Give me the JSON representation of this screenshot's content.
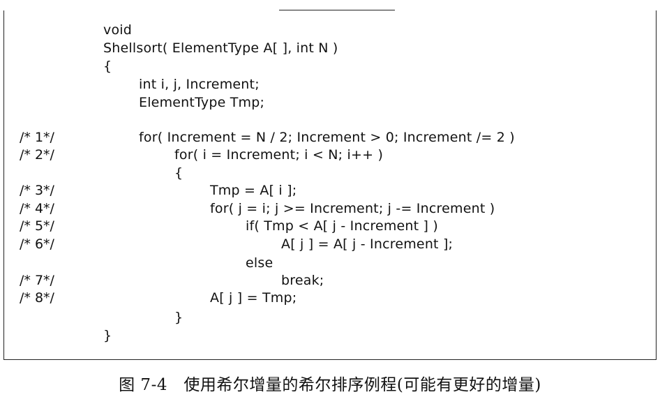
{
  "code": {
    "lines": [
      {
        "number": "",
        "text": "void",
        "indent": 0
      },
      {
        "number": "",
        "text": "Shellsort( ElementType A[ ], int N )",
        "indent": 0
      },
      {
        "number": "",
        "text": "{",
        "indent": 0
      },
      {
        "number": "",
        "text": "int i, j, Increment;",
        "indent": 1
      },
      {
        "number": "",
        "text": "ElementType Tmp;",
        "indent": 1
      },
      {
        "number": "",
        "text": "",
        "indent": 0
      },
      {
        "number": "/* 1*/",
        "text": "for( Increment = N / 2; Increment > 0; Increment /= 2 )",
        "indent": 1
      },
      {
        "number": "/* 2*/",
        "text": "for( i = Increment; i < N; i++ )",
        "indent": 2
      },
      {
        "number": "",
        "text": "{",
        "indent": 2
      },
      {
        "number": "/* 3*/",
        "text": "Tmp = A[ i ];",
        "indent": 3
      },
      {
        "number": "/* 4*/",
        "text": "for( j = i; j >= Increment; j -= Increment )",
        "indent": 3
      },
      {
        "number": "/* 5*/",
        "text": "if( Tmp < A[ j - Increment ] )",
        "indent": 4
      },
      {
        "number": "/* 6*/",
        "text": "A[ j ] = A[ j - Increment ];",
        "indent": 5
      },
      {
        "number": "",
        "text": "else",
        "indent": 4
      },
      {
        "number": "/* 7*/",
        "text": "break;",
        "indent": 5
      },
      {
        "number": "/* 8*/",
        "text": "A[ j ] = Tmp;",
        "indent": 3
      },
      {
        "number": "",
        "text": "}",
        "indent": 2
      },
      {
        "number": "",
        "text": "}",
        "indent": 0
      }
    ]
  },
  "caption": "图 7-4   使用希尔增量的希尔排序例程(可能有更好的增量)"
}
